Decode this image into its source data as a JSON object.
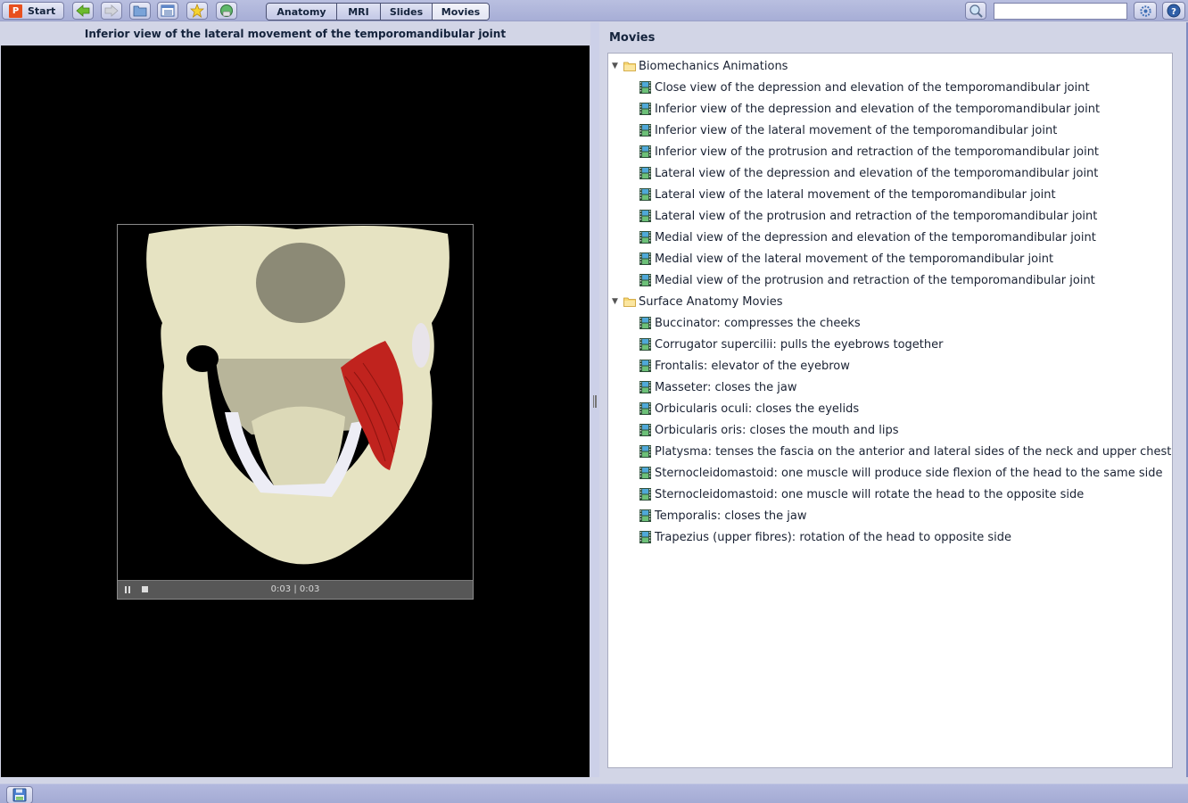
{
  "toolbar": {
    "start_label": "Start",
    "start_logo": "P",
    "icons": [
      "back-arrow-icon",
      "forward-arrow-icon",
      "folder-icon",
      "list-icon",
      "favorites-star-icon",
      "globe-icon"
    ],
    "tabs": [
      {
        "label": "Anatomy",
        "active": false
      },
      {
        "label": "MRI",
        "active": false
      },
      {
        "label": "Slides",
        "active": false
      },
      {
        "label": "Movies",
        "active": true
      }
    ],
    "search": {
      "value": "",
      "placeholder": ""
    }
  },
  "player": {
    "title": "Inferior view of the lateral movement of the temporomandibular joint",
    "current_time": "0:03",
    "separator": "|",
    "duration": "0:03",
    "state": "playing"
  },
  "movies_panel": {
    "heading": "Movies",
    "folders": [
      {
        "label": "Biomechanics Animations",
        "expanded": true,
        "items": [
          "Close view of the depression and elevation of the temporomandibular joint",
          "Inferior view of the depression and elevation of the temporomandibular joint",
          "Inferior view of the lateral movement of the temporomandibular joint",
          "Inferior view of the protrusion and retraction of the temporomandibular joint",
          "Lateral view of the depression and elevation of the temporomandibular joint",
          "Lateral view of the lateral movement of the temporomandibular joint",
          "Lateral view of the protrusion and retraction of the temporomandibular joint",
          "Medial view of the depression and elevation of the temporomandibular joint",
          "Medial view of the lateral movement of the temporomandibular joint",
          "Medial view of the protrusion and retraction of the temporomandibular joint"
        ]
      },
      {
        "label": "Surface Anatomy Movies",
        "expanded": true,
        "items": [
          "Buccinator: compresses the cheeks",
          "Corrugator supercilii: pulls the eyebrows together",
          "Frontalis: elevator of the eyebrow",
          "Masseter: closes the jaw",
          "Orbicularis oculi: closes the eyelids",
          "Orbicularis oris: closes the mouth and lips",
          "Platysma: tenses the fascia on the anterior and lateral sides of the neck and upper chest",
          "Sternocleidomastoid: one muscle will produce side flexion of the head to the same side",
          "Sternocleidomastoid: one muscle will rotate the head to the opposite side",
          "Temporalis: closes the jaw",
          "Trapezius (upper fibres): rotation of the head to opposite side"
        ]
      }
    ]
  },
  "colors": {
    "toolbar_bg": "#a7aed6",
    "panel_bg": "#d2d5e6",
    "start_logo": "#e8501e",
    "muscle_red": "#c0231e",
    "bone": "#e6e3c2"
  }
}
